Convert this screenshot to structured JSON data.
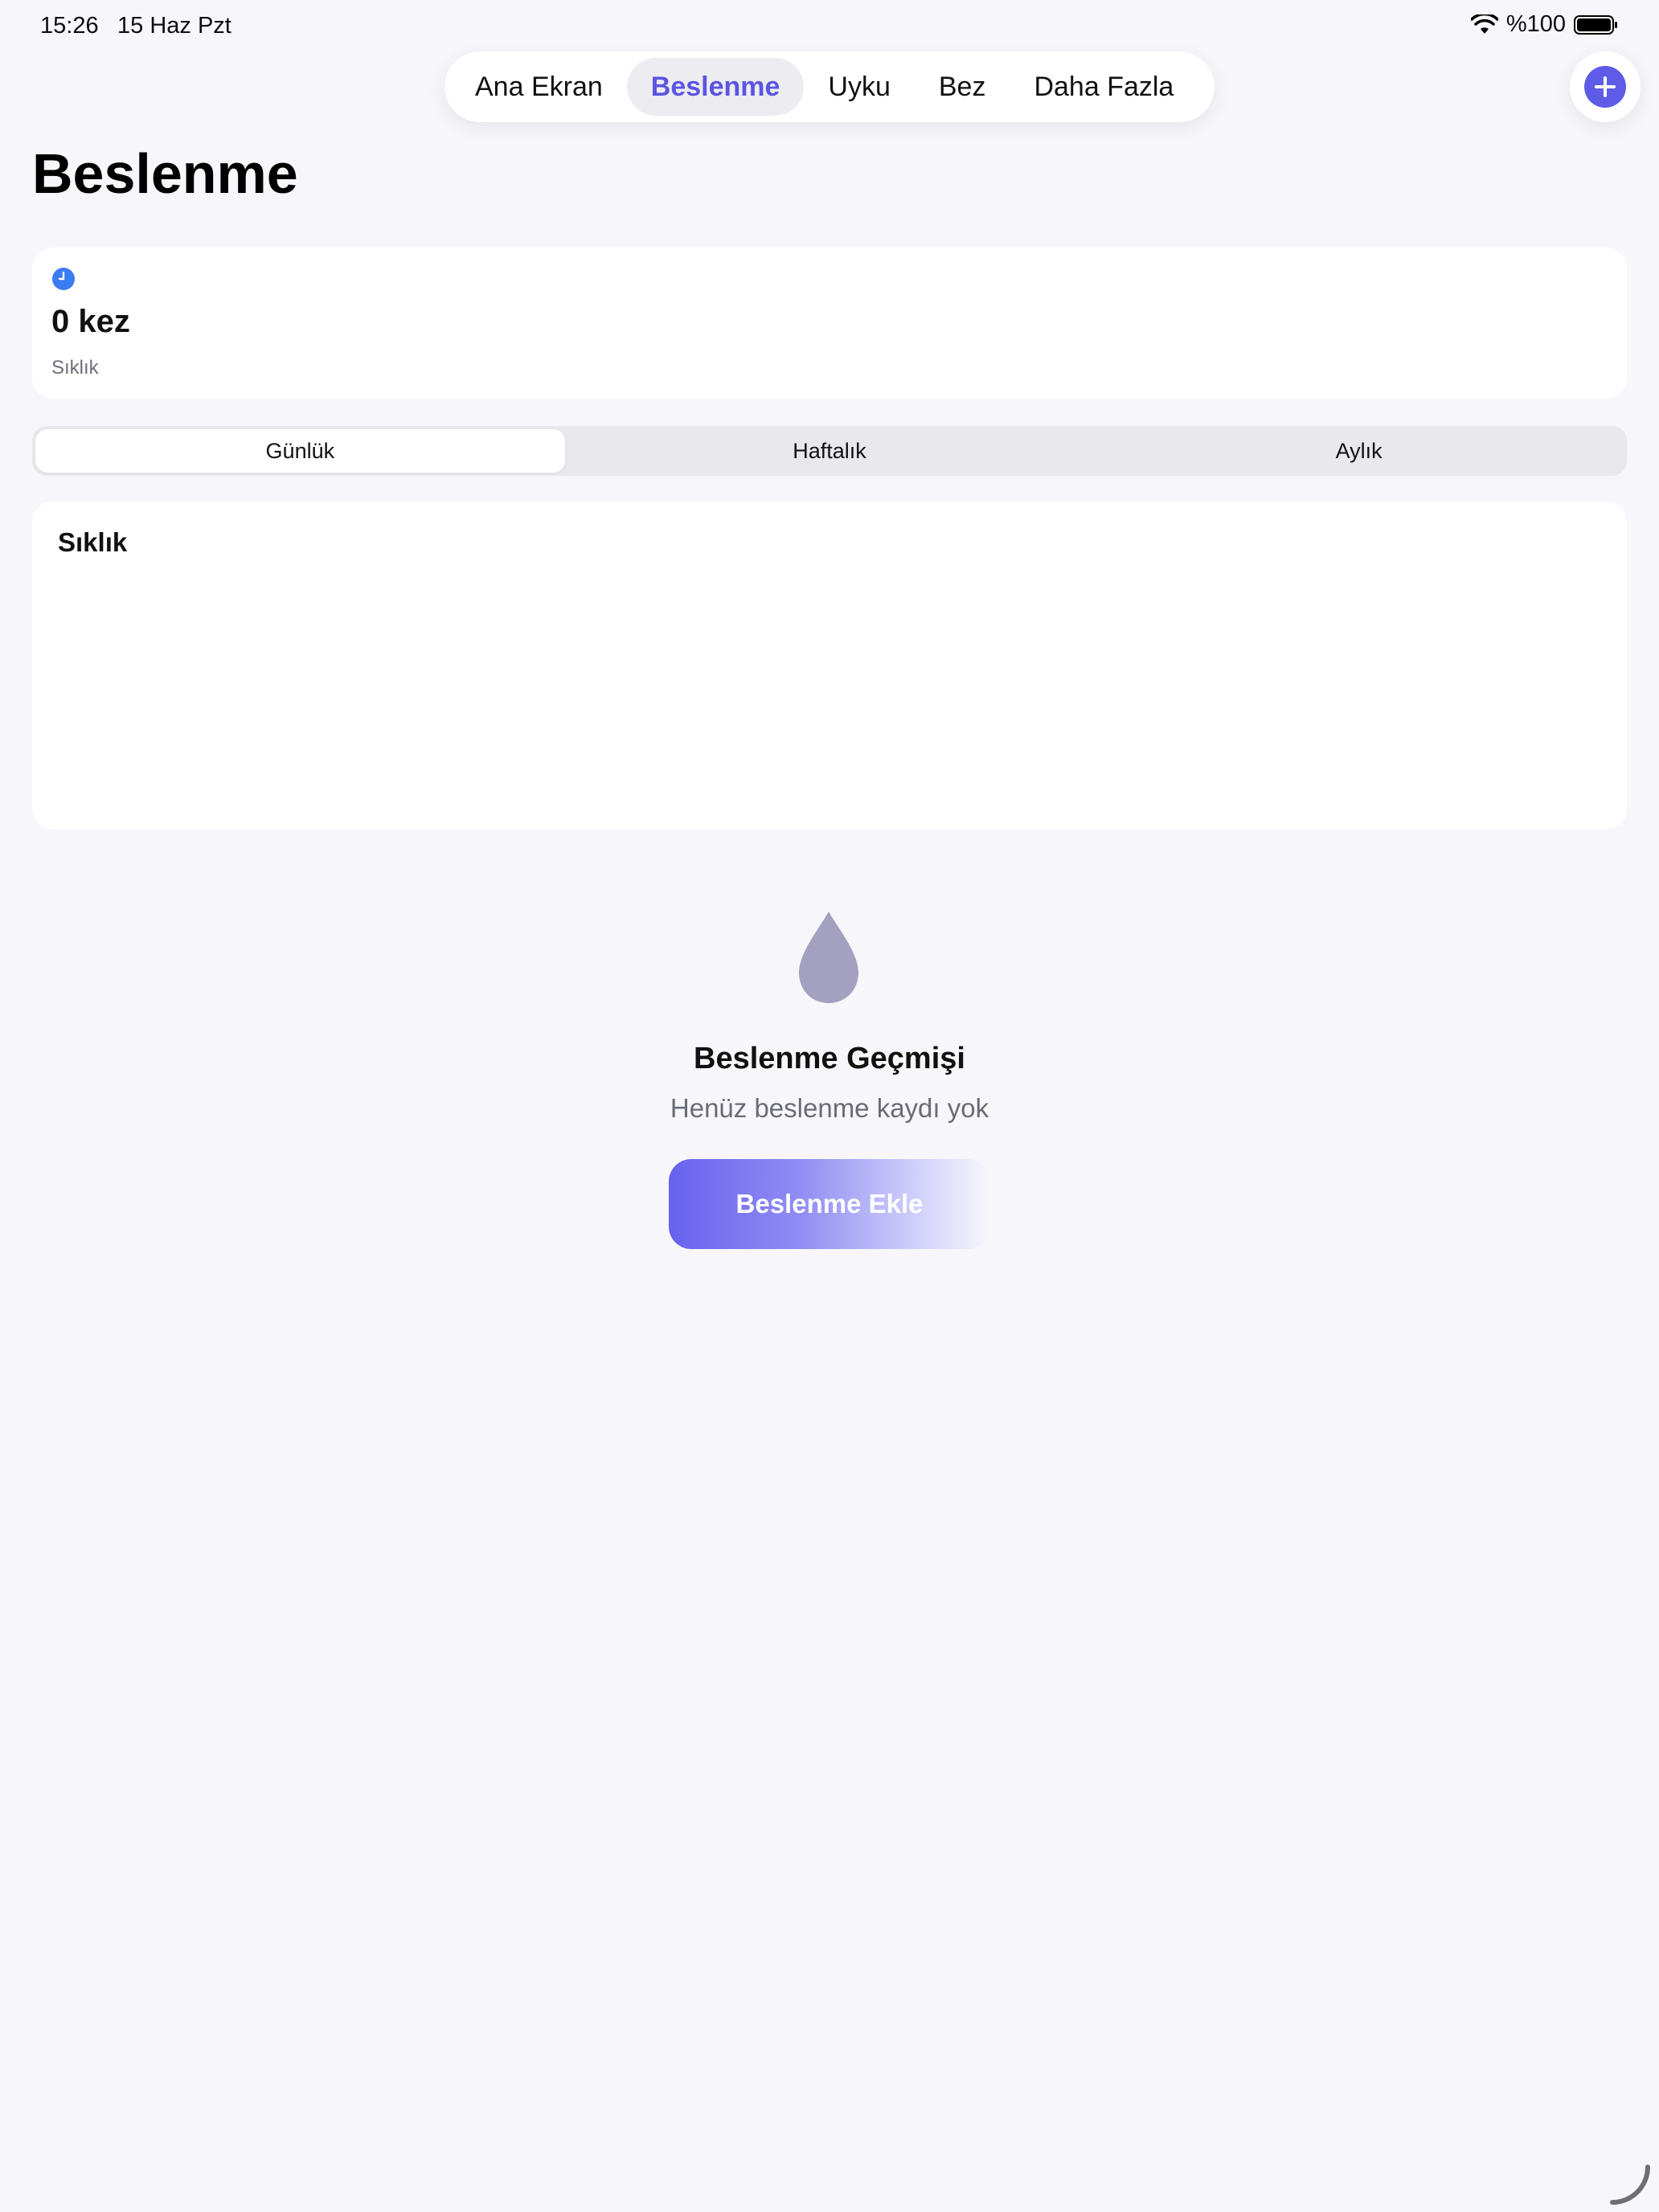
{
  "status_bar": {
    "time": "15:26",
    "date": "15 Haz Pzt",
    "battery": "%100"
  },
  "tabs": [
    {
      "label": "Ana Ekran",
      "active": false
    },
    {
      "label": "Beslenme",
      "active": true
    },
    {
      "label": "Uyku",
      "active": false
    },
    {
      "label": "Bez",
      "active": false
    },
    {
      "label": "Daha Fazla",
      "active": false
    }
  ],
  "page": {
    "title": "Beslenme"
  },
  "stat_card": {
    "value": "0 kez",
    "label": "Sıklık",
    "icon": "clock-icon"
  },
  "period_selector": [
    {
      "label": "Günlük",
      "active": true
    },
    {
      "label": "Haftalık",
      "active": false
    },
    {
      "label": "Aylık",
      "active": false
    }
  ],
  "chart_card": {
    "title": "Sıklık"
  },
  "empty_state": {
    "icon": "drop-icon",
    "title": "Beslenme Geçmişi",
    "subtitle": "Henüz beslenme kaydı yok",
    "button_label": "Beslenme Ekle"
  },
  "colors": {
    "accent": "#5e5ce6",
    "background": "#f7f7fb",
    "drop": "#a3a1bf",
    "clock": "#3a7cf2"
  }
}
